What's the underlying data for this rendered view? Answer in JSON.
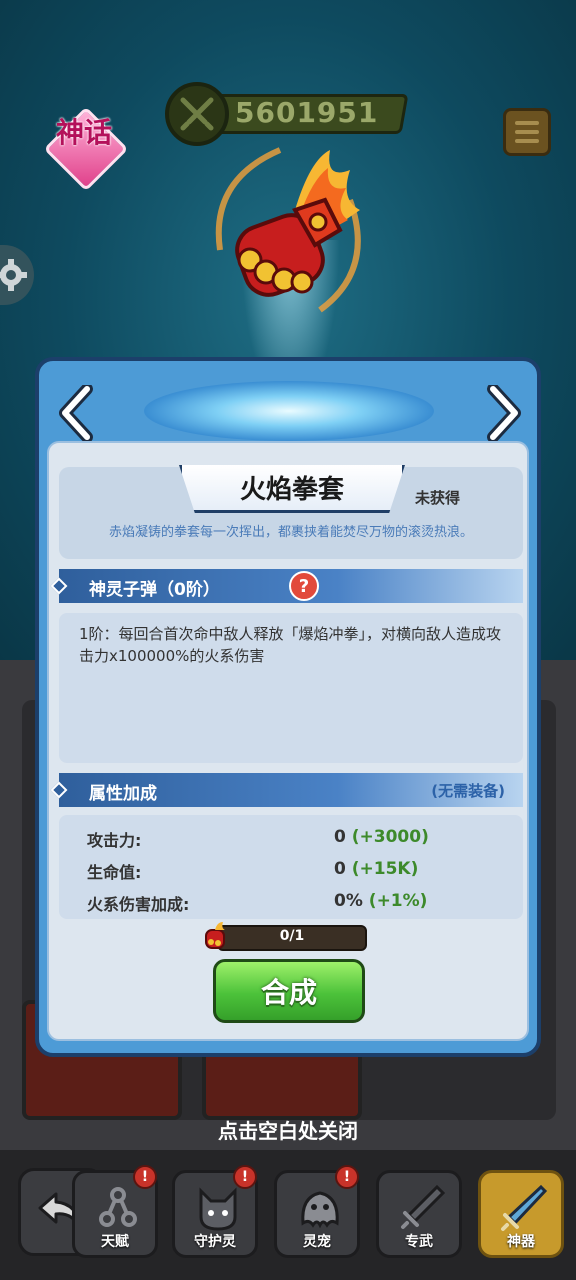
{
  "power": {
    "value": "5601951"
  },
  "rarity_badge": {
    "label": "神话"
  },
  "artifact": {
    "name": "火焰拳套",
    "status": "未获得",
    "description": "赤焰凝铸的拳套每一次挥出，都裹挟着能焚尽万物的滚烫热浪。"
  },
  "skill": {
    "title": "神灵子弹（0阶）",
    "help": "?",
    "text": "1阶：每回合首次命中敌人释放「爆焰冲拳」，对横向敌人造成攻击力x100000%的火系伤害"
  },
  "attributes": {
    "title": "属性加成",
    "note": "(无需装备)",
    "rows": [
      {
        "label": "攻击力:",
        "value": "0",
        "bonus": "(+3000)"
      },
      {
        "label": "生命值:",
        "value": "0",
        "bonus": "(+15K)"
      },
      {
        "label": "火系伤害加成:",
        "value": "0%",
        "bonus": "(+1%)"
      }
    ]
  },
  "progress": {
    "text": "0/1",
    "fraction": 0
  },
  "combine_button": {
    "label": "合成"
  },
  "close_hint": "点击空白处关闭",
  "nav": {
    "items": [
      {
        "label": "天赋",
        "badge": "!"
      },
      {
        "label": "守护灵",
        "badge": "!"
      },
      {
        "label": "灵宠",
        "badge": "!"
      },
      {
        "label": "专武",
        "badge": ""
      },
      {
        "label": "神器",
        "badge": ""
      }
    ]
  },
  "colors": {
    "panel": "#4d9bd6",
    "accent_green": "#4cc23a",
    "bonus_green": "#3d8a2b",
    "alert_red": "#c8332a"
  }
}
